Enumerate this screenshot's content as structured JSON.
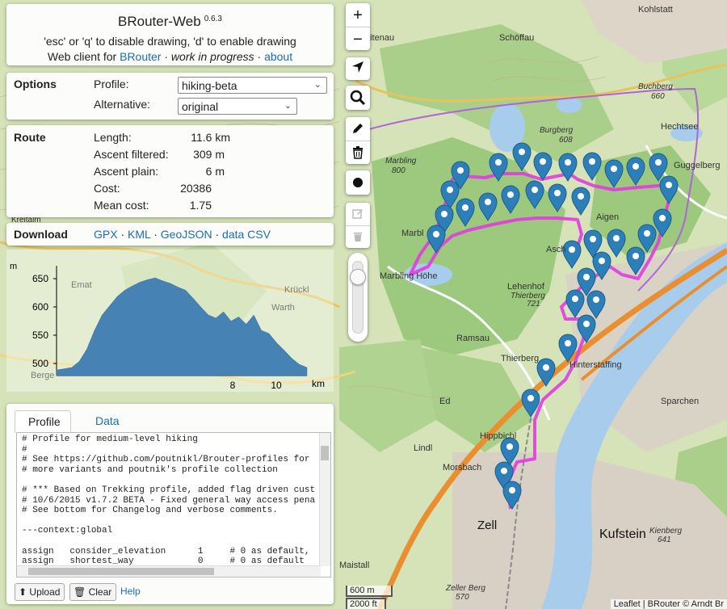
{
  "header": {
    "title": "BRouter-Web",
    "version": "0.6.3",
    "hint": "'esc' or 'q' to disable drawing, 'd' to enable drawing",
    "subtitle_prefix": "Web client for",
    "brouter_link": "BRouter",
    "sep1": "·",
    "wip": "work in progress",
    "sep2": "·",
    "about_link": "about"
  },
  "options": {
    "title": "Options",
    "profile_label": "Profile:",
    "profile_value": "hiking-beta",
    "alternative_label": "Alternative:",
    "alternative_value": "original"
  },
  "route": {
    "title": "Route",
    "length_label": "Length:",
    "length_value": "11.6 km",
    "ascent_filtered_label": "Ascent filtered:",
    "ascent_filtered_value": "309 m",
    "ascent_plain_label": "Ascent plain:",
    "ascent_plain_value": "6 m",
    "cost_label": "Cost:",
    "cost_value": "20386",
    "mean_cost_label": "Mean cost:",
    "mean_cost_value": "1.75"
  },
  "download": {
    "title": "Download",
    "gpx": "GPX",
    "kml": "KML",
    "geojson": "GeoJSON",
    "csv": "data CSV",
    "sep": "·"
  },
  "elevation_chart": {
    "y_unit": "m",
    "x_unit": "km",
    "y_ticks": [
      "650",
      "600",
      "550",
      "500"
    ],
    "x_ticks": [
      "8",
      "10"
    ],
    "color": "#4682b4",
    "profile": [
      496,
      498,
      500,
      510,
      530,
      560,
      585,
      600,
      615,
      625,
      632,
      638,
      642,
      645,
      640,
      636,
      630,
      625,
      612,
      598,
      585,
      580,
      590,
      575,
      582,
      570,
      585,
      560,
      555,
      540,
      528,
      515,
      505,
      500
    ]
  },
  "profile_panel": {
    "tab_profile": "Profile",
    "tab_data": "Data",
    "code_lines": [
      "# Profile for medium-level hiking",
      "#",
      "# See https://github.com/poutnikl/Brouter-profiles for",
      "# more variants and poutnik's profile collection",
      "",
      "# *** Based on Trekking profile, added flag driven cust",
      "# 10/6/2015 v1.7.2 BETA - Fixed general way access pena",
      "# See bottom for Changelog and verbose comments.",
      "",
      "---context:global",
      "",
      "assign   consider_elevation      1     # 0 as default,",
      "assign   shortest_way            0     # 0 as default"
    ],
    "upload_label": "Upload",
    "clear_label": "Clear",
    "help_label": "Help"
  },
  "map": {
    "zoom_in": "+",
    "zoom_out": "−",
    "scale_m": "600 m",
    "scale_ft": "2000 ft",
    "attribution": "Leaflet | BRouter © Arndt Br",
    "route_color": "#e23be0",
    "marker_color": "#2c7fb8",
    "places": [
      {
        "name": "Kohlstatt"
      },
      {
        "name": "Schöffau"
      },
      {
        "name": "eitenau"
      },
      {
        "name": "Buchberg"
      },
      {
        "name": "660"
      },
      {
        "name": "Hechtsee"
      },
      {
        "name": "Burgberg"
      },
      {
        "name": "608"
      },
      {
        "name": "Guggelberg"
      },
      {
        "name": "Marbling"
      },
      {
        "name": "800"
      },
      {
        "name": "Marbl"
      },
      {
        "name": "Aigen"
      },
      {
        "name": "Asch"
      },
      {
        "name": "Marbling Höhe"
      },
      {
        "name": "Lehenhof"
      },
      {
        "name": "Thierberg"
      },
      {
        "name": "721"
      },
      {
        "name": "Ramsau"
      },
      {
        "name": "Thierberg"
      },
      {
        "name": "Hinterstaffing"
      },
      {
        "name": "Ed"
      },
      {
        "name": "Sparchen"
      },
      {
        "name": "Hippbichl"
      },
      {
        "name": "Lindl"
      },
      {
        "name": "Morsbach"
      },
      {
        "name": "Zell"
      },
      {
        "name": "Kufstein"
      },
      {
        "name": "Kienberg"
      },
      {
        "name": "641"
      },
      {
        "name": "Maistall"
      },
      {
        "name": "Zeller Berg"
      },
      {
        "name": "570"
      },
      {
        "name": "Emat"
      },
      {
        "name": "Krückl"
      },
      {
        "name": "Warth"
      },
      {
        "name": "Kreitalm"
      },
      {
        "name": "Berge"
      }
    ]
  }
}
